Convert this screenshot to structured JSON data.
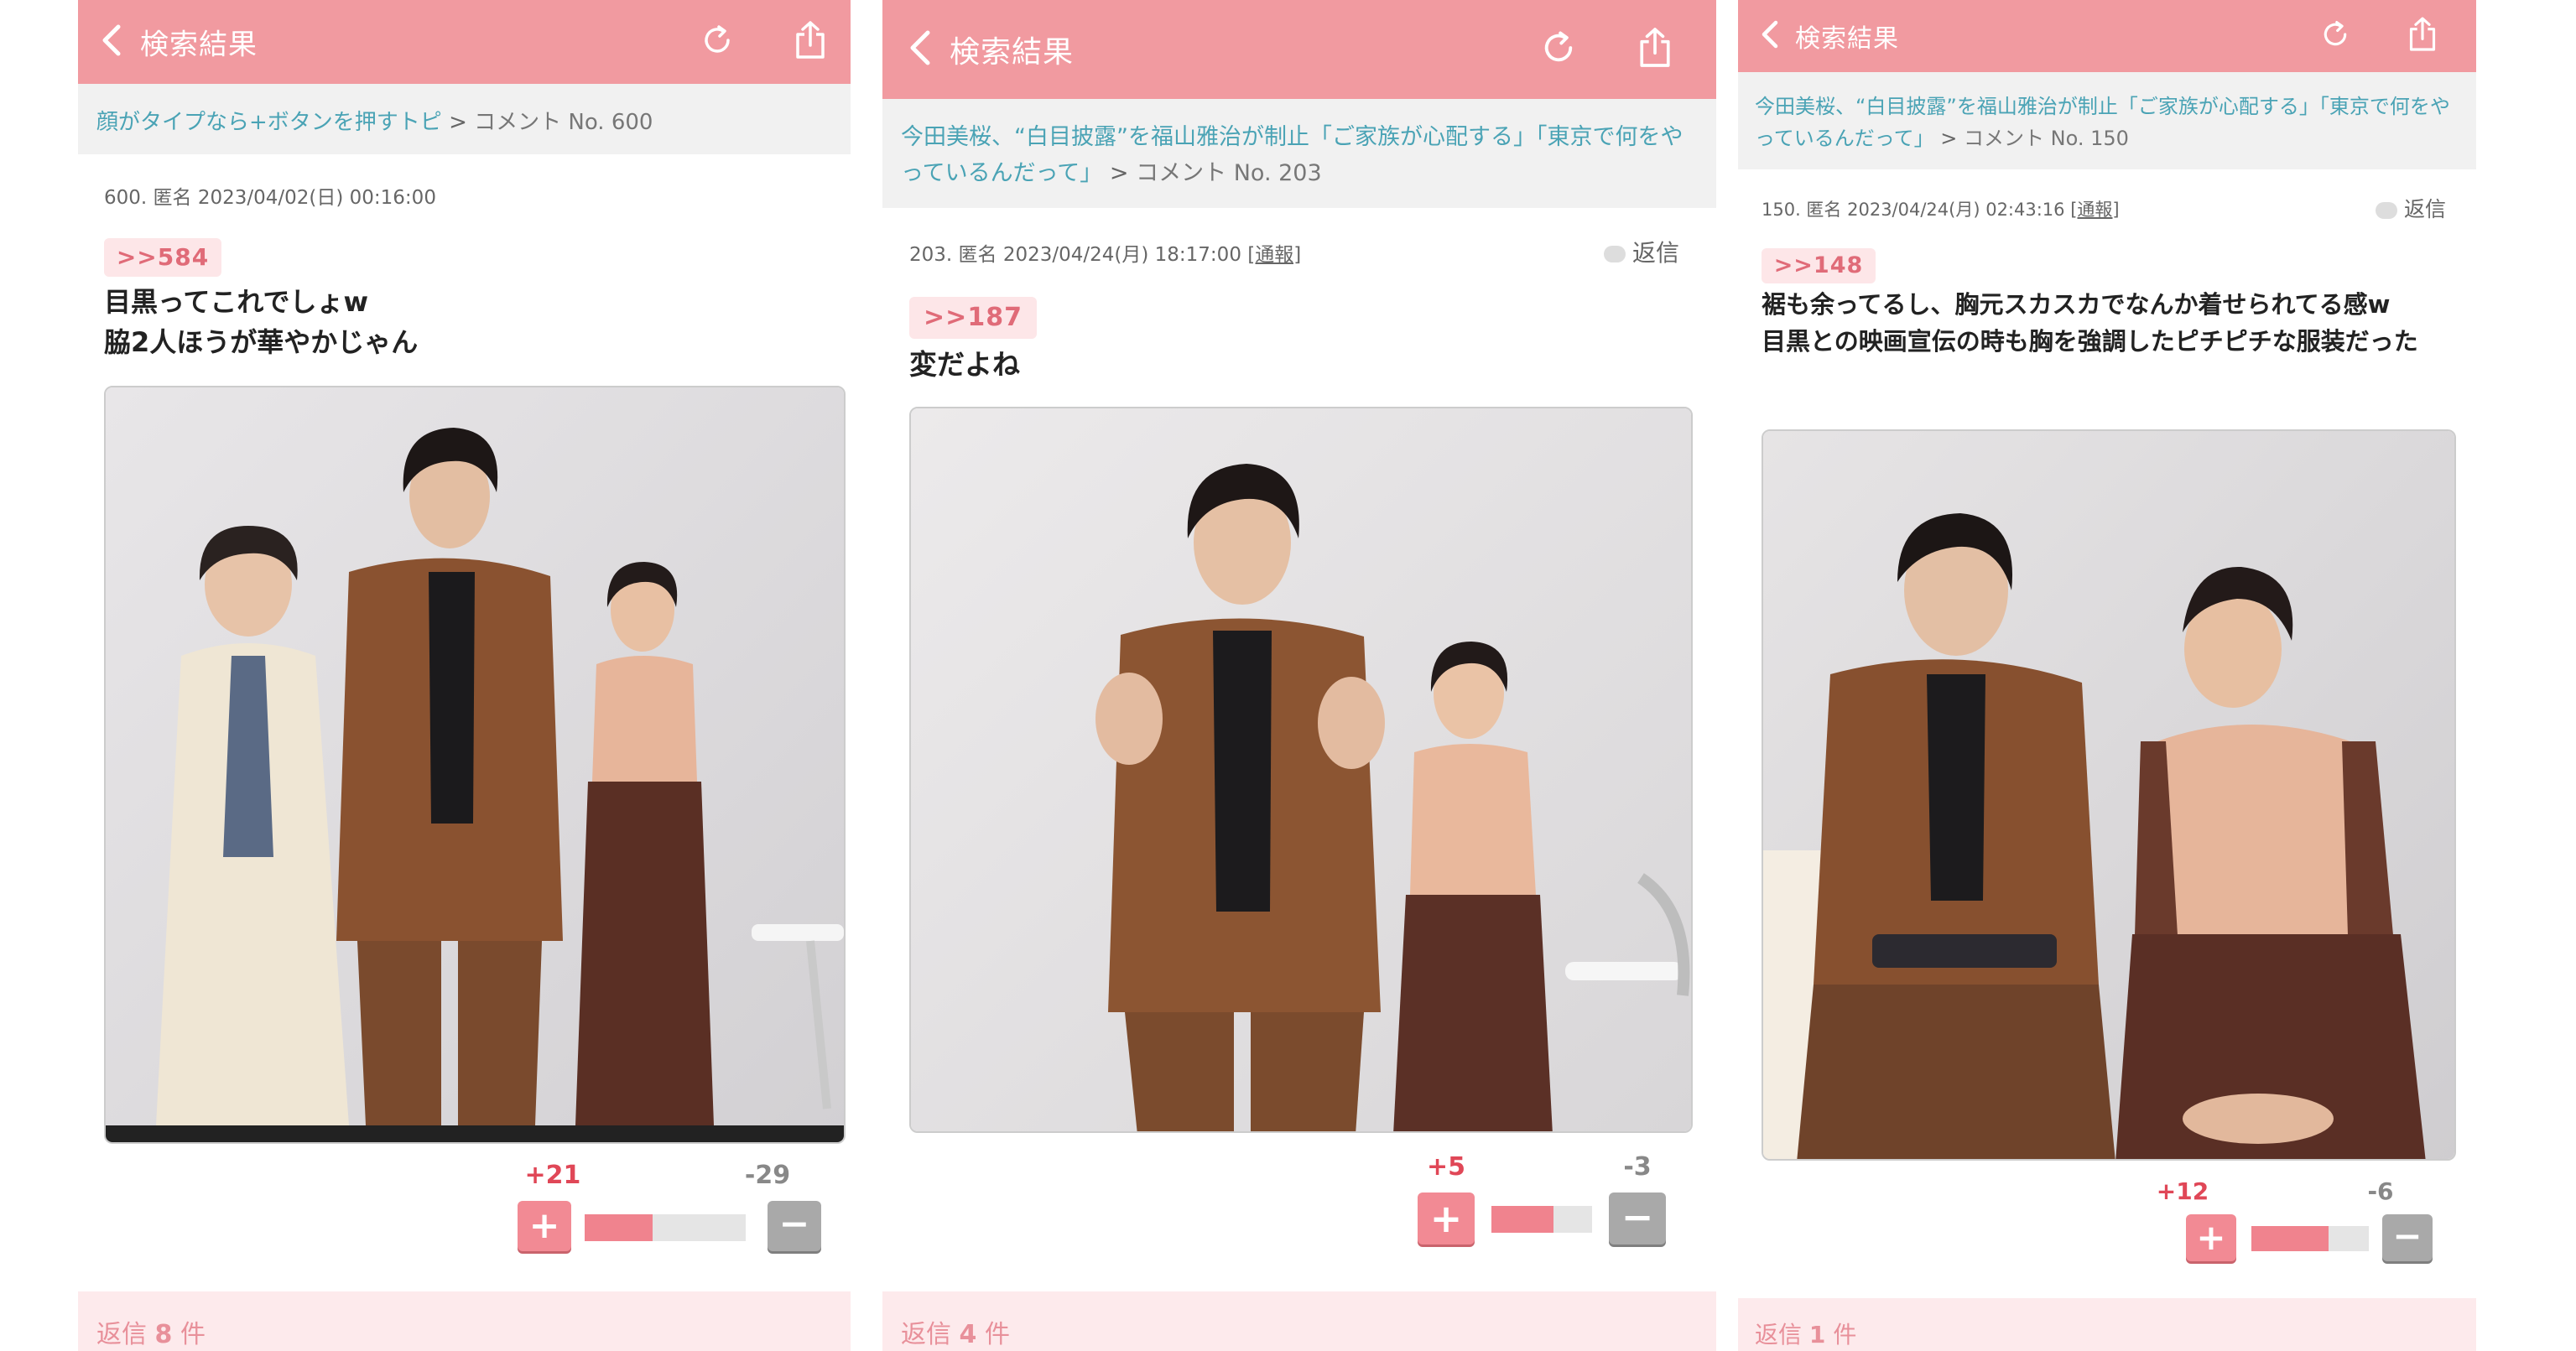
{
  "header": {
    "back_label": "検索結果"
  },
  "panels": [
    {
      "breadcrumb_topic": "顔がタイプなら+ボタンを押すトピ",
      "breadcrumb_sep": ">",
      "breadcrumb_comment": "コメント No. 600",
      "meta": "600. 匿名 2023/04/02(日) 00:16:00",
      "anchor": ">>584",
      "body_line1": "目黒ってこれでしょw",
      "body_line2": "脇2人ほうが華やかじゃん",
      "plus_count": "+21",
      "minus_count": "-29",
      "plus_ratio": 0.42,
      "replies_label": "返信",
      "replies_count": "8",
      "replies_unit": "件"
    },
    {
      "breadcrumb_topic": "今田美桜、“白目披露”を福山雅治が制止「ご家族が心配する」「東京で何をやっているんだって」",
      "breadcrumb_sep": ">",
      "breadcrumb_comment": "コメント No. 203",
      "meta": "203. 匿名 2023/04/24(月) 18:17:00",
      "report": "[通報]",
      "reply": "返信",
      "anchor": ">>187",
      "body_line1": "変だよね",
      "plus_count": "+5",
      "minus_count": "-3",
      "plus_ratio": 0.62,
      "replies_label": "返信",
      "replies_count": "4",
      "replies_unit": "件"
    },
    {
      "breadcrumb_topic": "今田美桜、“白目披露”を福山雅治が制止「ご家族が心配する」「東京で何をやっているんだって」",
      "breadcrumb_sep": ">",
      "breadcrumb_comment": "コメント No. 150",
      "meta": "150. 匿名 2023/04/24(月) 02:43:16",
      "report": "[通報]",
      "reply": "返信",
      "anchor": ">>148",
      "body_line1": "裾も余ってるし、胸元スカスカでなんか着せられてる感w",
      "body_line2": "目黒との映画宣伝の時も胸を強調したピチピチな服装だった",
      "plus_count": "+12",
      "minus_count": "-6",
      "plus_ratio": 0.66,
      "replies_label": "返信",
      "replies_count": "1",
      "replies_unit": "件"
    }
  ],
  "colors": {
    "header_bg": "#f19aa0",
    "link": "#4aa3b5",
    "anchor_text": "#e06b78",
    "plus": "#f28a94",
    "minus": "#a9a9a9"
  },
  "icons": [
    "chevron-left-icon",
    "refresh-icon",
    "share-icon",
    "speech-bubble-icon"
  ]
}
